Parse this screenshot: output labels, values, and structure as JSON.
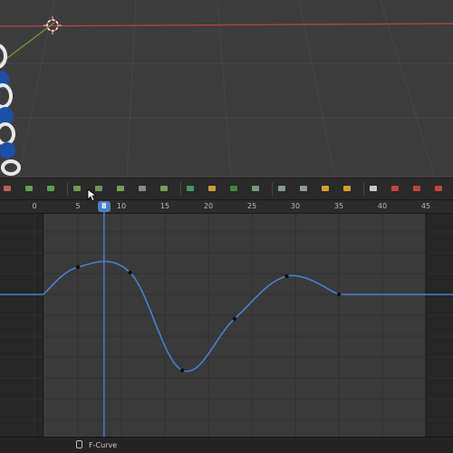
{
  "editor": "Graph Editor",
  "frame_ruler": {
    "ticks": [
      "0",
      "5",
      "10",
      "15",
      "20",
      "25",
      "30",
      "35",
      "40",
      "45"
    ],
    "current_frame": "8"
  },
  "curve": {
    "color": "#4a7fc6",
    "keyframes": [
      {
        "frame": 5,
        "value": 0.45
      },
      {
        "frame": 11,
        "value": 0.36
      },
      {
        "frame": 17,
        "value": -1.25
      },
      {
        "frame": 23,
        "value": -0.4
      },
      {
        "frame": 29,
        "value": 0.3
      },
      {
        "frame": 35,
        "value": 0.0
      }
    ]
  },
  "toolbar": {
    "icons": [
      "proportional-icon",
      "snap-icon",
      "pivot-icon",
      "keyframe-insert-icon",
      "handle-type-icon",
      "interpolation-icon",
      "easing-icon",
      "extrapolation-icon",
      "modifier-icon",
      "select-all-icon",
      "select-box-icon",
      "select-lasso-icon",
      "transform-icon",
      "mirror-icon",
      "bake-icon",
      "normalize-icon",
      "ghost-icon",
      "channel-icon",
      "key-icon",
      "delete-icon"
    ]
  },
  "status": {
    "label": "F-Curve"
  },
  "colors": {
    "accent": "#4b7fc7",
    "viewport_bg": "#3d3d3d",
    "graph_bg": "#3a3a3a",
    "graph_out_of_range": "#262626",
    "x_axis": "#b4444a",
    "y_axis": "#6e9a3a"
  }
}
